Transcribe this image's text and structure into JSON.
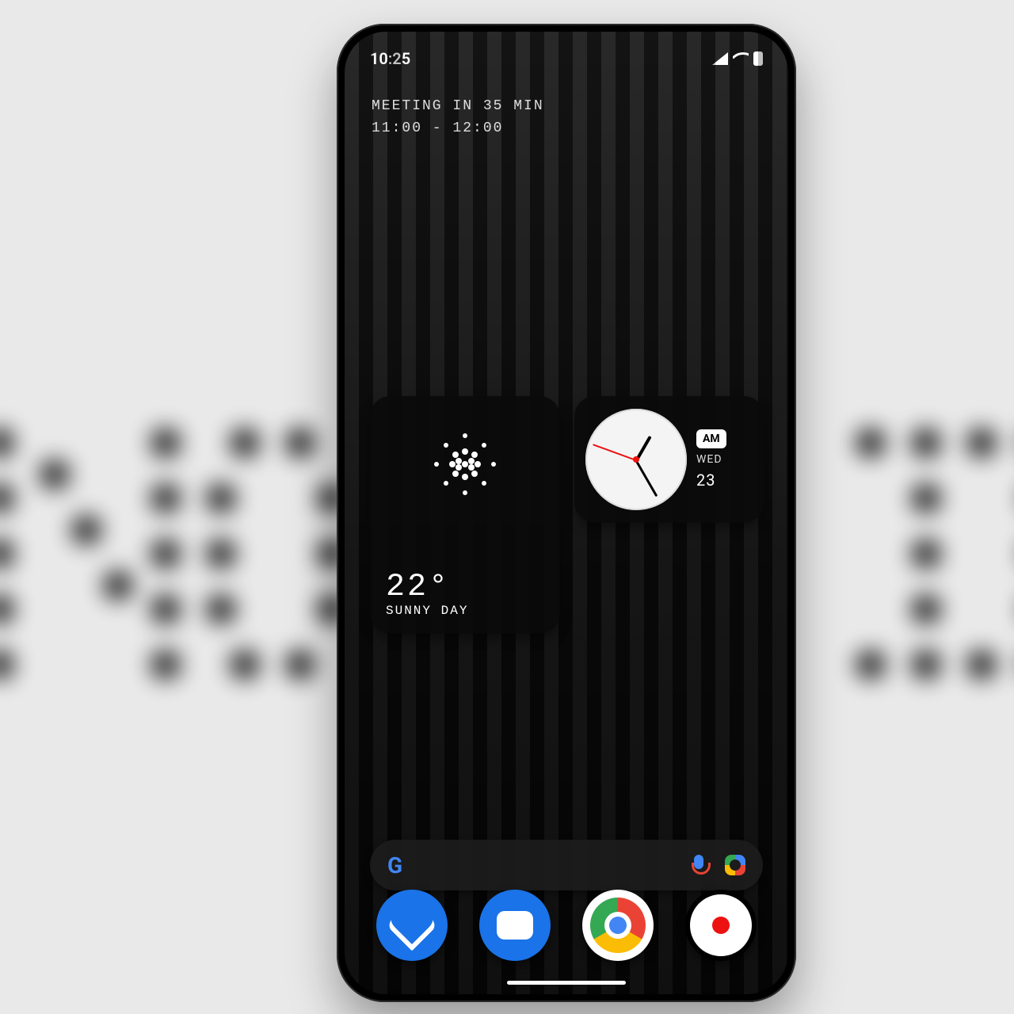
{
  "status": {
    "time": "10:25"
  },
  "event": {
    "title": "MEETING IN 35 MIN",
    "time": "11:00 - 12:00"
  },
  "weather": {
    "temp": "22°",
    "condition": "SUNNY DAY"
  },
  "clock": {
    "ampm": "AM",
    "day": "WED",
    "date": "23"
  },
  "search": {
    "google_label": "G"
  },
  "dock": {
    "phone": "Phone",
    "messages": "Messages",
    "chrome": "Chrome",
    "camera": "Camera"
  }
}
